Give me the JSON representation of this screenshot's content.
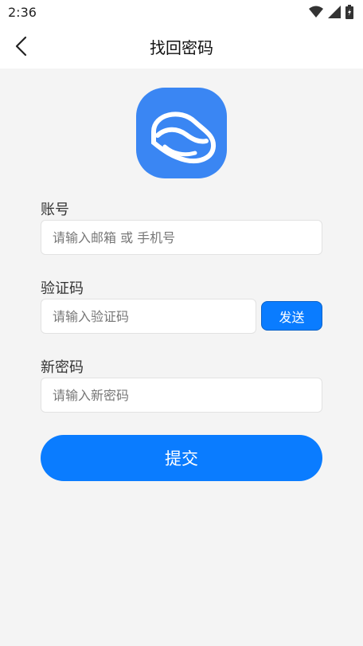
{
  "status_bar": {
    "time": "2:36",
    "icons": [
      "wifi-icon",
      "signal-icon",
      "battery-icon"
    ]
  },
  "header": {
    "title": "找回密码",
    "back_icon": "chevron-left-icon"
  },
  "logo": {
    "icon": "cloud-logo-icon",
    "color": "#3a86f3"
  },
  "form": {
    "account": {
      "label": "账号",
      "placeholder": "请输入邮箱 或 手机号",
      "value": ""
    },
    "code": {
      "label": "验证码",
      "placeholder": "请输入验证码",
      "value": "",
      "send_label": "发送"
    },
    "new_password": {
      "label": "新密码",
      "placeholder": "请输入新密码",
      "value": ""
    },
    "submit_label": "提交"
  },
  "colors": {
    "accent": "#0a7cff",
    "background": "#f4f4f4"
  }
}
